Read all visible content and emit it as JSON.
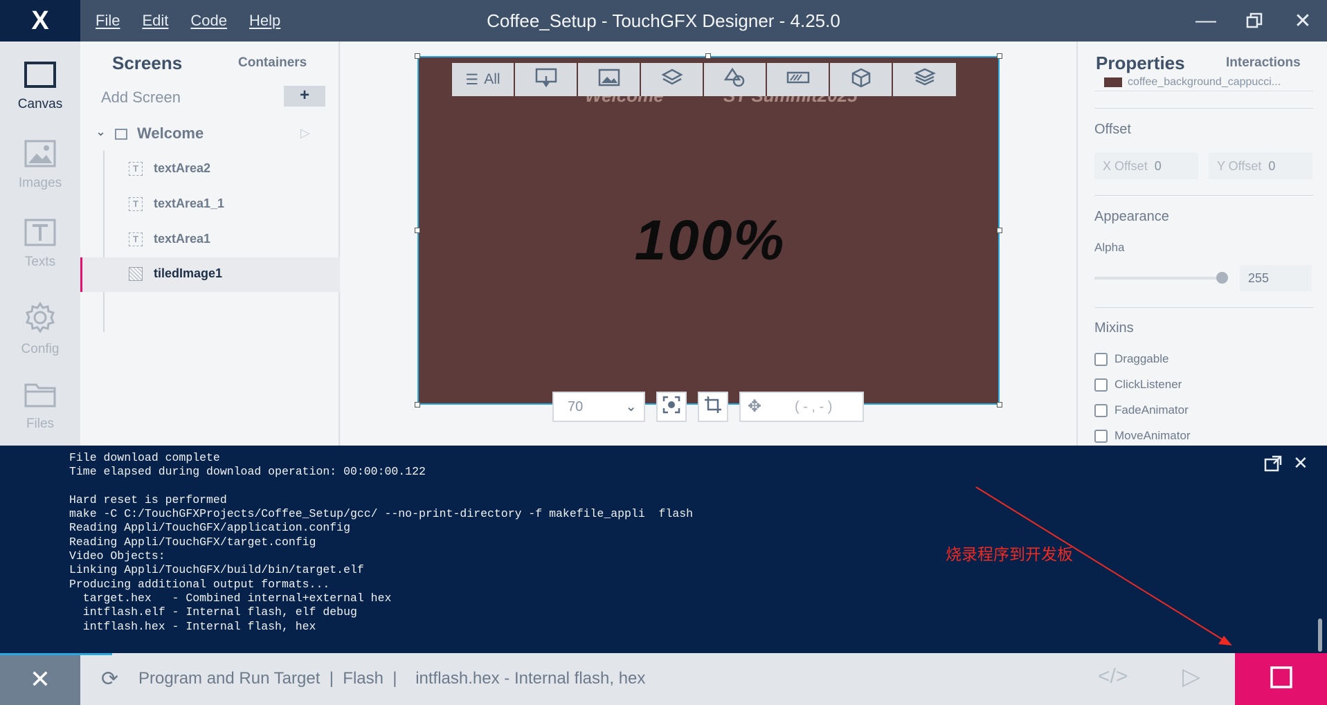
{
  "titlebar": {
    "logo": "X",
    "menu": [
      "File",
      "Edit",
      "Code",
      "Help"
    ],
    "title": "Coffee_Setup - TouchGFX Designer - 4.25.0"
  },
  "leftnav": {
    "items": [
      {
        "label": "Canvas",
        "icon": "canvas-icon"
      },
      {
        "label": "Images",
        "icon": "image-icon"
      },
      {
        "label": "Texts",
        "icon": "text-icon"
      },
      {
        "label": "Config",
        "icon": "gear-icon"
      },
      {
        "label": "Files",
        "icon": "folder-icon"
      }
    ]
  },
  "tree": {
    "tab_screens": "Screens",
    "tab_containers": "Containers",
    "add_screen": "Add Screen",
    "add_button": "+",
    "screen_name": "Welcome",
    "widgets": [
      {
        "name": "textArea2",
        "type": "T"
      },
      {
        "name": "textArea1_1",
        "type": "T"
      },
      {
        "name": "textArea1",
        "type": "T"
      },
      {
        "name": "tiledImage1",
        "type": "img"
      }
    ]
  },
  "canvas": {
    "filter_all": "All",
    "background_color": "#5c3b3a",
    "hint_left": "Welcome",
    "hint_right": "ST Summit2025",
    "big_text": "100%",
    "zoom": "70",
    "coords": "( - , - )"
  },
  "properties": {
    "title": "Properties",
    "interactions": "Interactions",
    "image_name": "coffee_background_cappucci...",
    "offset_title": "Offset",
    "x_offset_label": "X Offset",
    "x_offset_value": "0",
    "y_offset_label": "Y Offset",
    "y_offset_value": "0",
    "appearance_title": "Appearance",
    "alpha_label": "Alpha",
    "alpha_value": "255",
    "mixins_title": "Mixins",
    "mixins": [
      "Draggable",
      "ClickListener",
      "FadeAnimator",
      "MoveAnimator"
    ]
  },
  "console": {
    "lines": "File download complete\nTime elapsed during download operation: 00:00:00.122\n\nHard reset is performed\nmake -C C:/TouchGFXProjects/Coffee_Setup/gcc/ --no-print-directory -f makefile_appli  flash\nReading Appli/TouchGFX/application.config\nReading Appli/TouchGFX/target.config\nVideo Objects:\nLinking Appli/TouchGFX/build/bin/target.elf\nProducing additional output formats...\n  target.hex   - Combined internal+external hex\n  intflash.elf - Internal flash, elf debug\n  intflash.hex - Internal flash, hex",
    "annotation": "烧录程序到开发板",
    "annotation_color": "#ee2a22"
  },
  "statusbar": {
    "text": "Program and Run Target  |  Flash  |    intflash.hex - Internal flash, hex",
    "accent": "#e4106e"
  }
}
